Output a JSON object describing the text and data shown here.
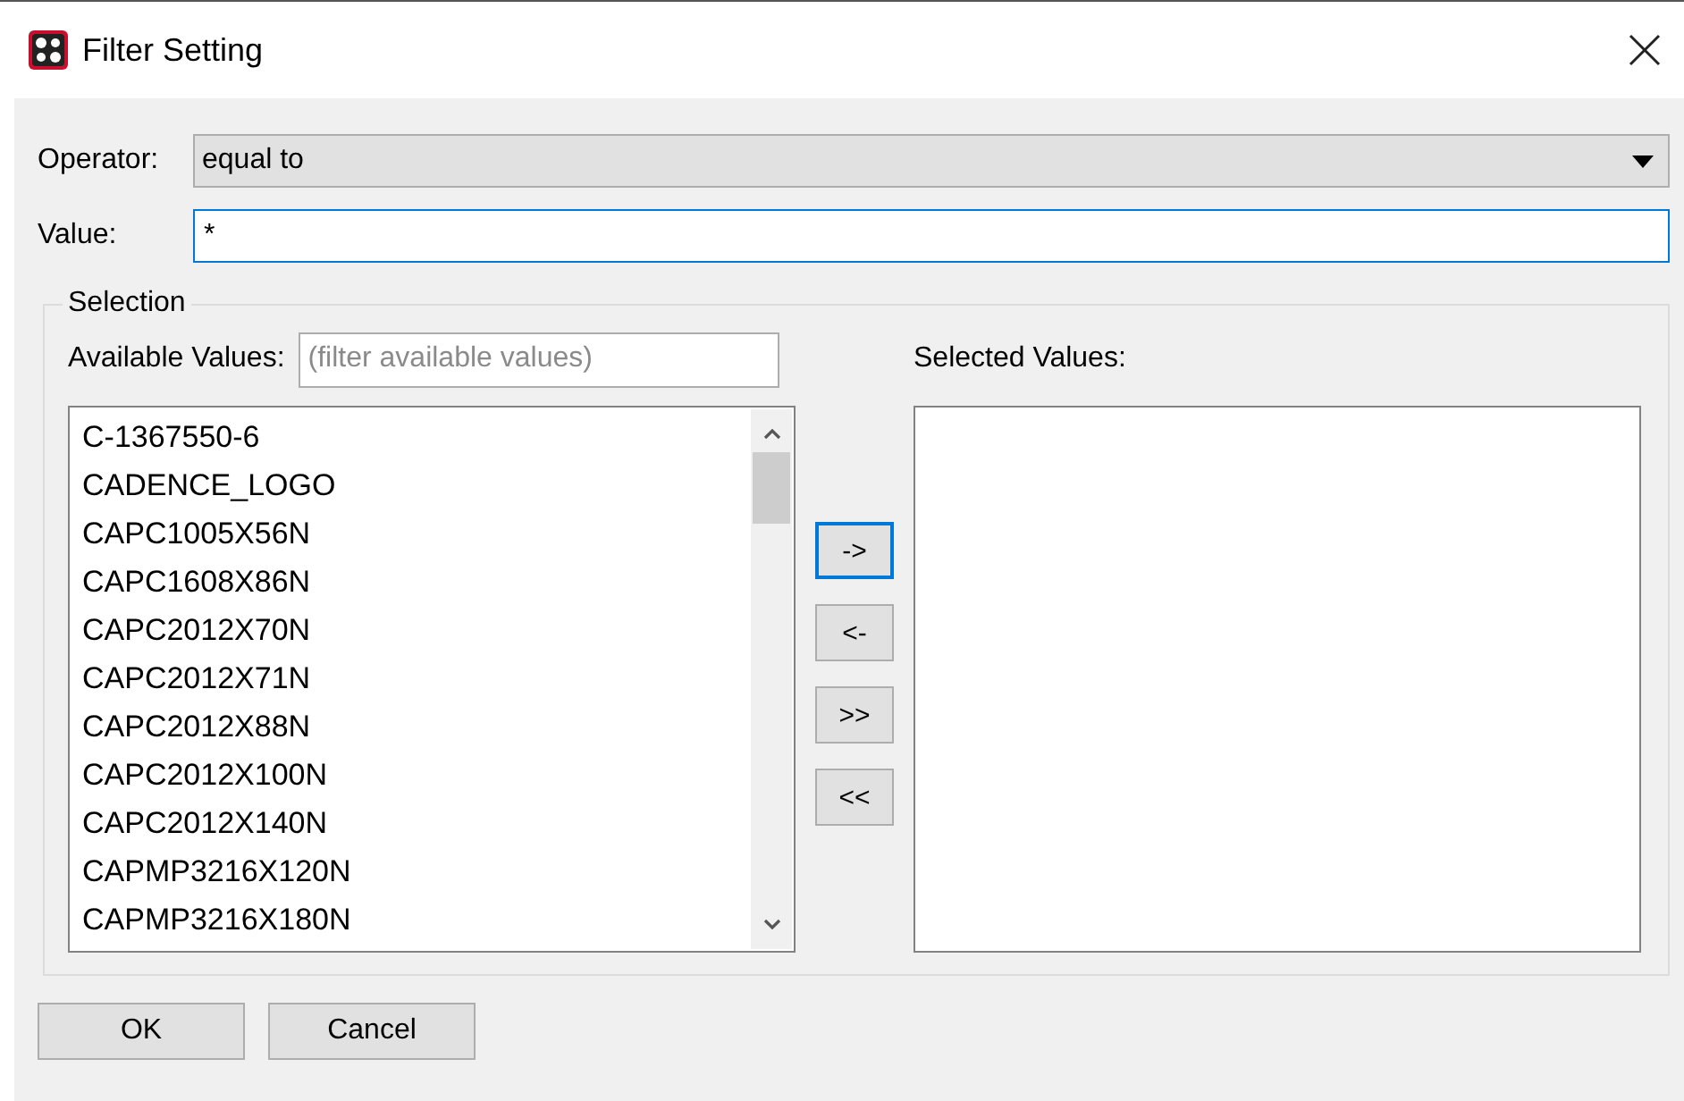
{
  "window": {
    "title": "Filter Setting"
  },
  "operator": {
    "label": "Operator:",
    "value": "equal to"
  },
  "value": {
    "label": "Value:",
    "value": "*",
    "focused": true
  },
  "selection": {
    "title": "Selection",
    "available": {
      "label": "Available Values:",
      "placeholder": "(filter available values)",
      "items": [
        "C-1367550-6",
        "CADENCE_LOGO",
        "CAPC1005X56N",
        "CAPC1608X86N",
        "CAPC2012X70N",
        "CAPC2012X71N",
        "CAPC2012X88N",
        "CAPC2012X100N",
        "CAPC2012X140N",
        "CAPMP3216X120N",
        "CAPMP3216X180N"
      ]
    },
    "move_buttons": [
      {
        "label": "->",
        "focused": true
      },
      {
        "label": "<-",
        "focused": false
      },
      {
        "label": ">>",
        "focused": false
      },
      {
        "label": "<<",
        "focused": false
      }
    ],
    "selected": {
      "label": "Selected Values:"
    }
  },
  "buttons": [
    "OK",
    "Cancel"
  ]
}
